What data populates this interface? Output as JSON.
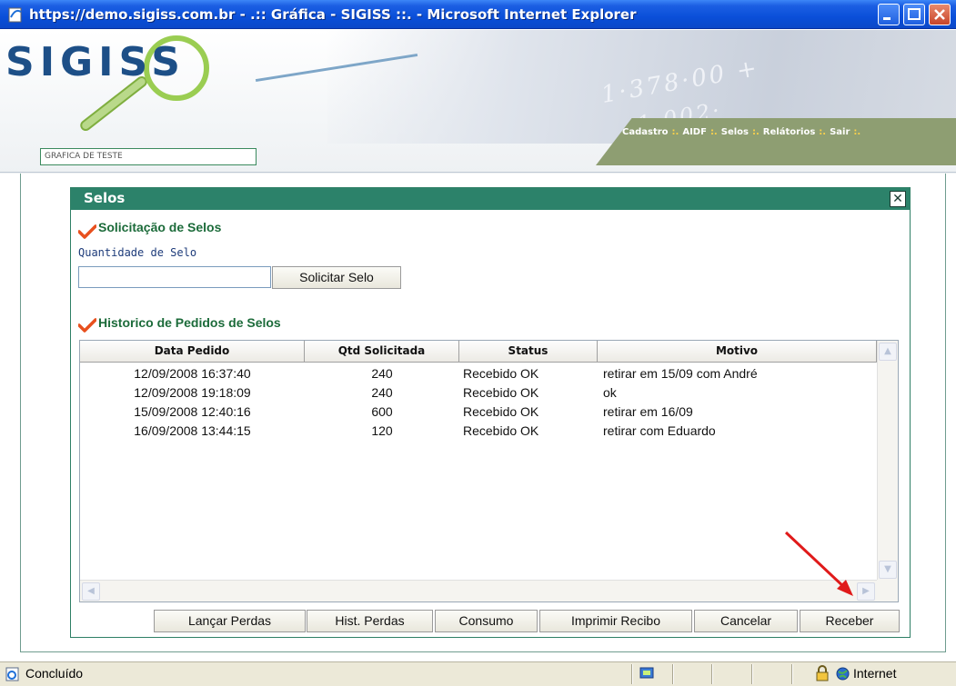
{
  "window": {
    "title": "https://demo.sigiss.com.br - .:: Gráfica - SIGISS ::. - Microsoft Internet Explorer"
  },
  "header": {
    "logo": "SIGISS",
    "banner_numbers": "1·378·00 +",
    "banner_numbers2": "1·002·",
    "company": "GRAFICA DE TESTE",
    "menu": [
      "Cadastro",
      "AIDF",
      "Selos",
      "Relátorios",
      "Sair"
    ],
    "menu_separator": ":."
  },
  "dialog": {
    "title": "Selos",
    "close_symbol": "✕",
    "request_section": {
      "title": "Solicitação de Selos",
      "quantity_label": "Quantidade de Selo",
      "quantity_value": "",
      "submit_label": "Solicitar Selo"
    },
    "history_section": {
      "title": "Historico de Pedidos de Selos",
      "columns": [
        "Data Pedido",
        "Qtd Solicitada",
        "Status",
        "Motivo"
      ],
      "rows": [
        {
          "date": "12/09/2008 16:37:40",
          "qty": "240",
          "status": "Recebido OK",
          "motivo": "retirar em 15/09 com André"
        },
        {
          "date": "12/09/2008 19:18:09",
          "qty": "240",
          "status": "Recebido OK",
          "motivo": "ok"
        },
        {
          "date": "15/09/2008 12:40:16",
          "qty": "600",
          "status": "Recebido OK",
          "motivo": "retirar em 16/09"
        },
        {
          "date": "16/09/2008 13:44:15",
          "qty": "120",
          "status": "Recebido OK",
          "motivo": "retirar com Eduardo"
        }
      ]
    },
    "actions": [
      "Lançar Perdas",
      "Hist. Perdas",
      "Consumo",
      "Imprimir Recibo",
      "Cancelar",
      "Receber"
    ]
  },
  "statusbar": {
    "status": "Concluído",
    "zone": "Internet"
  },
  "colors": {
    "titlebar": "#0a4fd9",
    "dialog_header": "#2c826a",
    "section_title": "#1c6b3a",
    "menu_bar": "#8e9e72",
    "annotation_arrow": "#e01a1a"
  }
}
